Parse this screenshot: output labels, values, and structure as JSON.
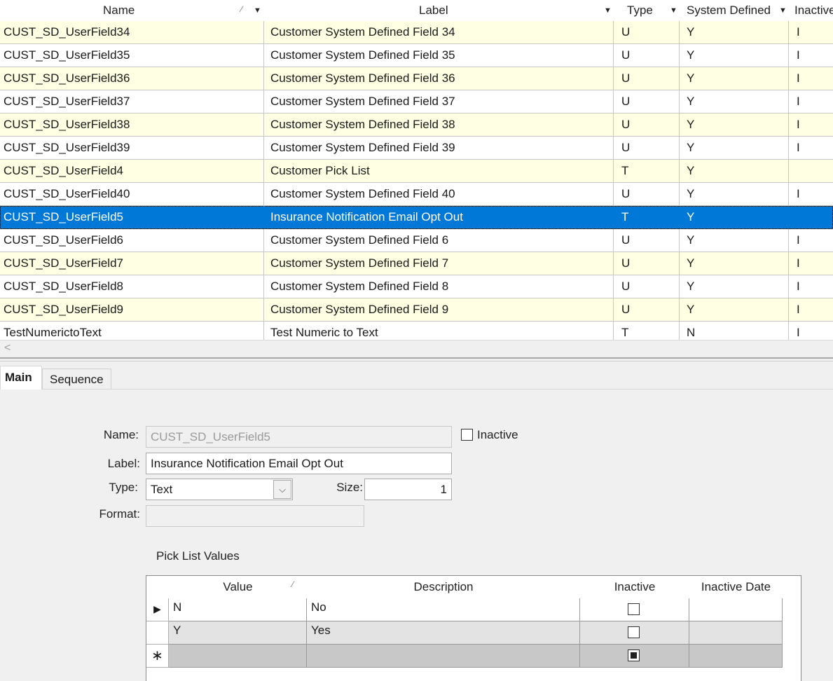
{
  "grid": {
    "columns": {
      "name": "Name",
      "label": "Label",
      "type": "Type",
      "system_defined": "System Defined",
      "inactive": "Inactive"
    },
    "rows": [
      {
        "name": "CUST_SD_UserField34",
        "label": "Customer System Defined Field 34",
        "type": "U",
        "system": "Y",
        "inactive": "I"
      },
      {
        "name": "CUST_SD_UserField35",
        "label": "Customer System Defined Field 35",
        "type": "U",
        "system": "Y",
        "inactive": "I"
      },
      {
        "name": "CUST_SD_UserField36",
        "label": "Customer System Defined Field 36",
        "type": "U",
        "system": "Y",
        "inactive": "I"
      },
      {
        "name": "CUST_SD_UserField37",
        "label": "Customer System Defined Field 37",
        "type": "U",
        "system": "Y",
        "inactive": "I"
      },
      {
        "name": "CUST_SD_UserField38",
        "label": "Customer System Defined Field 38",
        "type": "U",
        "system": "Y",
        "inactive": "I"
      },
      {
        "name": "CUST_SD_UserField39",
        "label": "Customer System Defined Field 39",
        "type": "U",
        "system": "Y",
        "inactive": "I"
      },
      {
        "name": "CUST_SD_UserField4",
        "label": "Customer Pick List",
        "type": "T",
        "system": "Y",
        "inactive": ""
      },
      {
        "name": "CUST_SD_UserField40",
        "label": "Customer System Defined Field 40",
        "type": "U",
        "system": "Y",
        "inactive": "I"
      },
      {
        "name": "CUST_SD_UserField5",
        "label": "Insurance Notification Email Opt Out",
        "type": "T",
        "system": "Y",
        "inactive": ""
      },
      {
        "name": "CUST_SD_UserField6",
        "label": "Customer System Defined Field 6",
        "type": "U",
        "system": "Y",
        "inactive": "I"
      },
      {
        "name": "CUST_SD_UserField7",
        "label": "Customer System Defined Field 7",
        "type": "U",
        "system": "Y",
        "inactive": "I"
      },
      {
        "name": "CUST_SD_UserField8",
        "label": "Customer System Defined Field 8",
        "type": "U",
        "system": "Y",
        "inactive": "I"
      },
      {
        "name": "CUST_SD_UserField9",
        "label": "Customer System Defined Field 9",
        "type": "U",
        "system": "Y",
        "inactive": "I"
      },
      {
        "name": "TestNumerictoText",
        "label": "Test Numeric to Text",
        "type": "T",
        "system": "N",
        "inactive": "I"
      }
    ]
  },
  "scroll": {
    "left_glyph": "<"
  },
  "tabs": {
    "main": "Main",
    "sequence": "Sequence"
  },
  "form": {
    "name_label": "Name:",
    "name_value": "CUST_SD_UserField5",
    "inactive_label": "Inactive",
    "label_label": "Label:",
    "label_value": "Insurance Notification Email Opt Out",
    "type_label": "Type:",
    "type_value": "Text",
    "size_label": "Size:",
    "size_value": "1",
    "format_label": "Format:",
    "format_value": ""
  },
  "picklist": {
    "title": "Pick List Values",
    "columns": {
      "value": "Value",
      "description": "Description",
      "inactive": "Inactive",
      "inactive_date": "Inactive Date"
    },
    "rows": [
      {
        "value": "N",
        "description": "No",
        "inactive_date": ""
      },
      {
        "value": "Y",
        "description": "Yes",
        "inactive_date": ""
      },
      {
        "value": "",
        "description": "",
        "inactive_date": ""
      }
    ]
  }
}
